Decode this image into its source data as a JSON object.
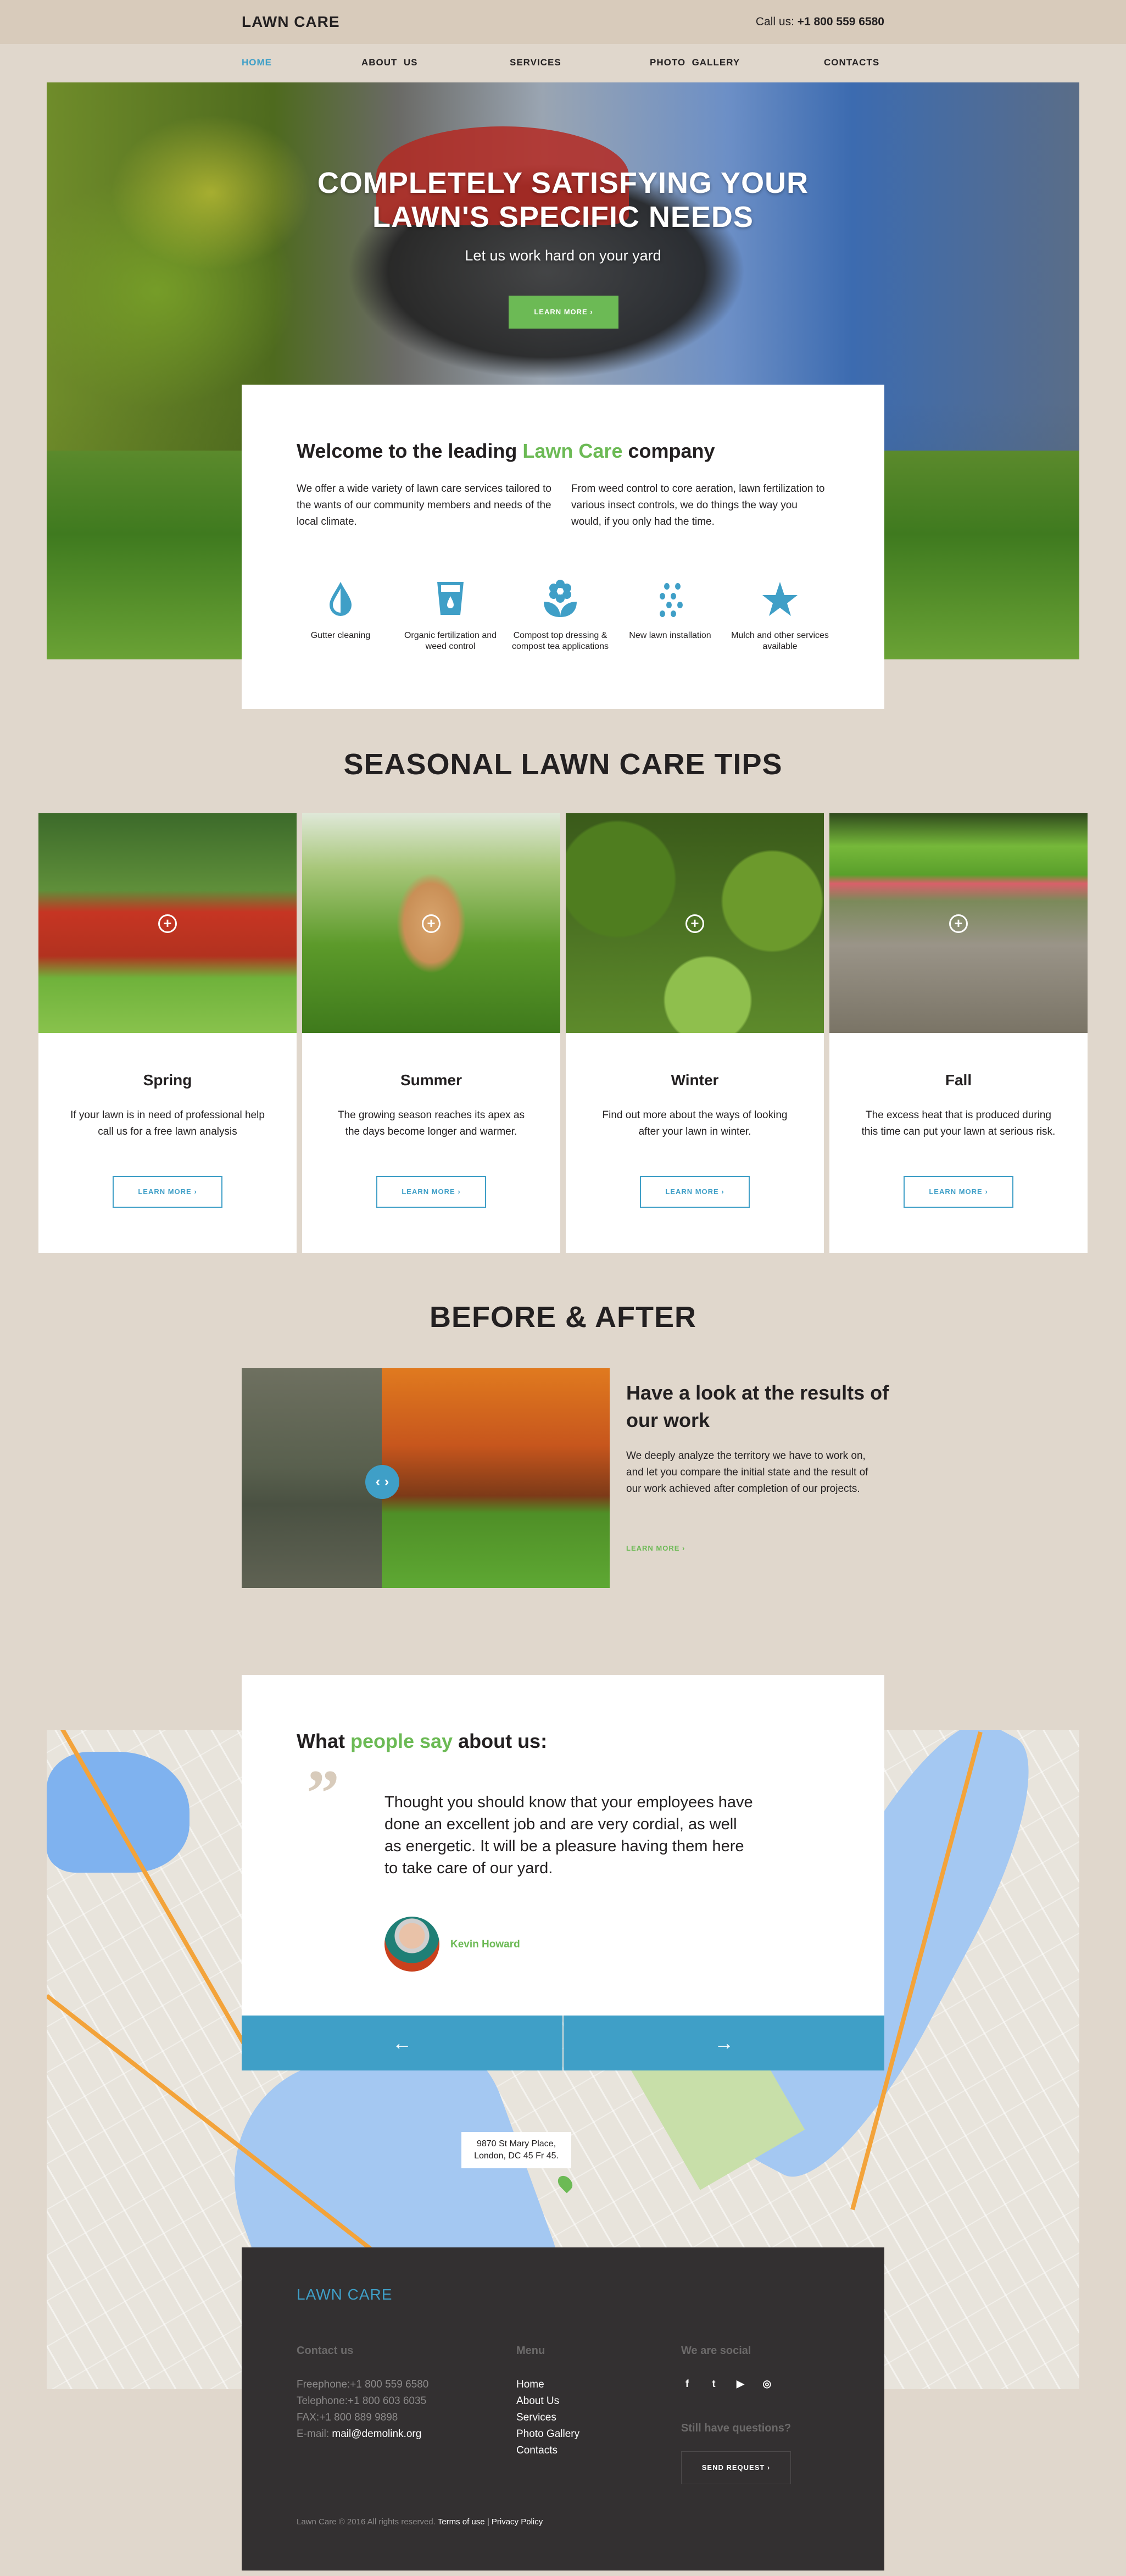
{
  "header": {
    "logo": "LAWN CARE",
    "call_label": "Call us:",
    "phone": "+1 800 559 6580"
  },
  "nav": {
    "items": [
      {
        "label": "HOME",
        "active": true
      },
      {
        "label": "ABOUT  US",
        "active": false
      },
      {
        "label": "SERVICES",
        "active": false
      },
      {
        "label": "PHOTO  GALLERY",
        "active": false
      },
      {
        "label": "CONTACTS",
        "active": false
      }
    ]
  },
  "hero": {
    "title_line1": "COMPLETELY SATISFYING YOUR",
    "title_line2": "LAWN'S SPECIFIC NEEDS",
    "subtitle": "Let us work hard on your yard",
    "button": "LEARN MORE ›"
  },
  "welcome": {
    "title_pre": "Welcome to the leading ",
    "title_accent": "Lawn Care",
    "title_post": " company",
    "col1": "We offer a wide variety of lawn care services tailored to the wants of our community members and needs of the local climate.",
    "col2": "From weed control to core aeration, lawn fertilization to various insect controls, we do things the way you would, if you only had the time.",
    "services": [
      {
        "icon": "water-drop-icon",
        "label": "Gutter cleaning"
      },
      {
        "icon": "glass-drop-icon",
        "label": "Organic fertilization and weed control"
      },
      {
        "icon": "flower-icon",
        "label": "Compost top dressing & compost tea applications"
      },
      {
        "icon": "seeds-icon",
        "label": "New lawn installation"
      },
      {
        "icon": "star-icon",
        "label": "Mulch and other services available"
      }
    ]
  },
  "seasonal": {
    "title": "SEASONAL LAWN CARE TIPS",
    "cards": [
      {
        "title": "Spring",
        "text": "If your lawn is in need of professional help call us for a free lawn analysis",
        "button": "LEARN MORE ›"
      },
      {
        "title": "Summer",
        "text": "The growing season reaches its apex as the days become longer and warmer.",
        "button": "LEARN MORE ›"
      },
      {
        "title": "Winter",
        "text": "Find out more about the ways of looking after your lawn in winter.",
        "button": "LEARN MORE ›"
      },
      {
        "title": "Fall",
        "text": "The excess heat that is produced during this time can put your lawn at serious risk.",
        "button": "LEARN MORE ›"
      }
    ]
  },
  "before_after": {
    "title": "BEFORE & AFTER",
    "heading": "Have a look at the results of our work",
    "text": "We deeply analyze the territory we have to work on, and let you compare the initial state and the result of our work achieved after completion of our projects.",
    "link": "LEARN MORE ›",
    "slider_position": 0.38
  },
  "testimonials": {
    "title_pre": "What ",
    "title_accent": "people say",
    "title_post": " about us:",
    "quote": "Thought you should know that your employees have done an excellent job and are very cordial, as well as energetic. It will be a pleasure having them here to take care of our yard.",
    "author": "Kevin Howard",
    "prev": "←",
    "next": "→"
  },
  "map": {
    "address_line1": "9870 St Mary Place,",
    "address_line2": "London, DC 45 Fr 45."
  },
  "footer": {
    "logo": "LAWN CARE",
    "contact_heading": "Contact us",
    "freephone": "Freephone:+1 800 559 6580",
    "telephone": "Telephone:+1 800 603 6035",
    "fax": "FAX:+1 800 889 9898",
    "email_label": "E-mail: ",
    "email": "mail@demolink.org",
    "menu_heading": "Menu",
    "menu": [
      "Home",
      "About Us",
      "Services",
      "Photo Gallery",
      "Contacts"
    ],
    "social_heading": "We are social",
    "social": [
      {
        "icon": "facebook-icon",
        "glyph": "f"
      },
      {
        "icon": "twitter-icon",
        "glyph": "t"
      },
      {
        "icon": "youtube-icon",
        "glyph": "▶"
      },
      {
        "icon": "instagram-icon",
        "glyph": "◎"
      }
    ],
    "questions_heading": "Still have questions?",
    "send_button": "SEND REQUEST ›",
    "copyright": "Lawn Care © 2016 All rights reserved. ",
    "terms": "Terms of use",
    "separator": " | ",
    "privacy": "Privacy Policy"
  },
  "colors": {
    "accent_blue": "#3f9fc7",
    "accent_green": "#6cba55",
    "background": "#e0d7cc",
    "footer_bg": "#333031"
  }
}
